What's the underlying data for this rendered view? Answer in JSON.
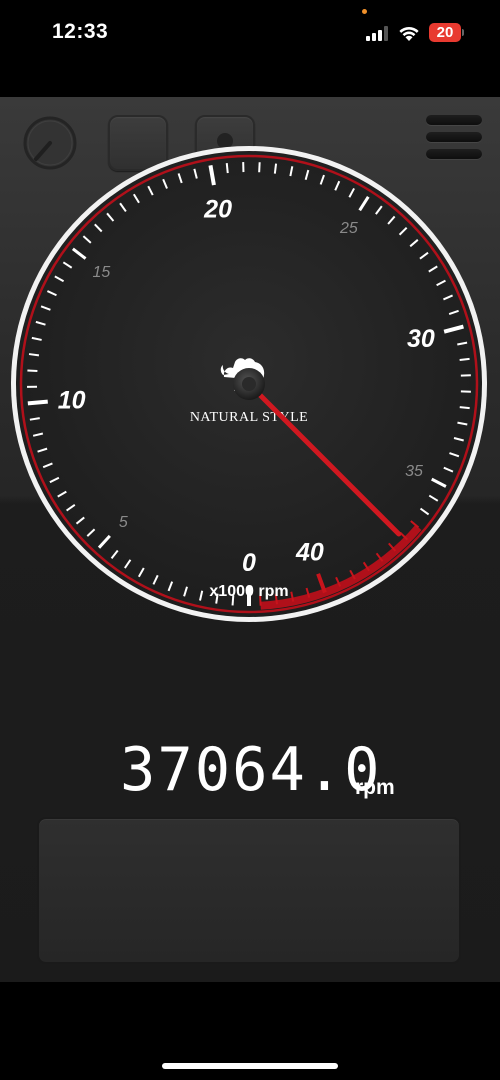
{
  "status_bar": {
    "time": "12:33",
    "battery_level": "20",
    "battery_color": "#e83a30",
    "icons": [
      "cellular-signal-icon",
      "wifi-icon",
      "battery-icon"
    ]
  },
  "toolbar": {
    "buttons": [
      "gauge-mode-icon",
      "blank-button",
      "record-icon",
      "menu-icon"
    ]
  },
  "gauge": {
    "unit_label": "x1000 rpm",
    "brand_label": "NATURAL STYLE",
    "major_labels": [
      "0",
      "10",
      "20",
      "30",
      "40"
    ],
    "minor_labels": [
      "5",
      "15",
      "25",
      "35"
    ],
    "min": 0,
    "max": 42,
    "redline_start": 36.5,
    "needle_value": 37.064,
    "accent_color": "#c8141c"
  },
  "readout": {
    "value": "37064.0",
    "unit": "rpm"
  }
}
